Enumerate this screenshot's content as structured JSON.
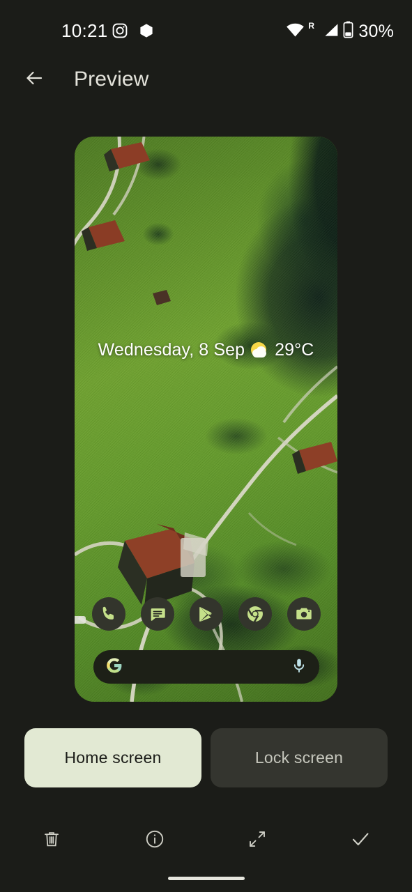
{
  "status_bar": {
    "time": "10:21",
    "left_icons": [
      "instagram-icon",
      "hexagon-icon"
    ],
    "network": {
      "wifi": "wifi-icon",
      "roaming_label": "R",
      "signal": "cell-signal-icon",
      "battery_icon": "battery-icon",
      "battery_text": "30%"
    }
  },
  "app_bar": {
    "back_icon": "back-arrow-icon",
    "title": "Preview"
  },
  "preview": {
    "wallpaper_description": "Aerial photo of green alpine meadows with winding footpaths, red-roofed farmhouses and dark forest",
    "date_widget": {
      "date": "Wednesday, 8 Sep",
      "weather_icon": "partly-sunny-icon",
      "temperature": "29°C"
    },
    "dock": {
      "apps": [
        {
          "name": "phone-app-icon",
          "label": "Phone"
        },
        {
          "name": "messages-app-icon",
          "label": "Messages"
        },
        {
          "name": "play-store-app-icon",
          "label": "Play Store"
        },
        {
          "name": "chrome-app-icon",
          "label": "Chrome"
        },
        {
          "name": "camera-app-icon",
          "label": "Camera"
        }
      ]
    },
    "search": {
      "google_icon": "google-g-icon",
      "mic_icon": "microphone-icon",
      "placeholder": ""
    }
  },
  "screen_toggle": {
    "options": [
      {
        "label": "Home screen",
        "selected": true
      },
      {
        "label": "Lock screen",
        "selected": false
      }
    ]
  },
  "bottom_toolbar": {
    "items": [
      {
        "name": "delete-button",
        "icon": "trash-icon",
        "label": "Delete"
      },
      {
        "name": "info-button",
        "icon": "info-circle-icon",
        "label": "Info"
      },
      {
        "name": "fullscreen-button",
        "icon": "expand-arrows-icon",
        "label": "Full screen"
      },
      {
        "name": "apply-button",
        "icon": "check-icon",
        "label": "Apply"
      }
    ]
  },
  "colors": {
    "background": "#1b1c18",
    "accent_selected": "#e2e9d3",
    "surface_unselected": "#34352f",
    "on_surface": "#e4e3db",
    "icon_tint": "#c5e08a"
  }
}
